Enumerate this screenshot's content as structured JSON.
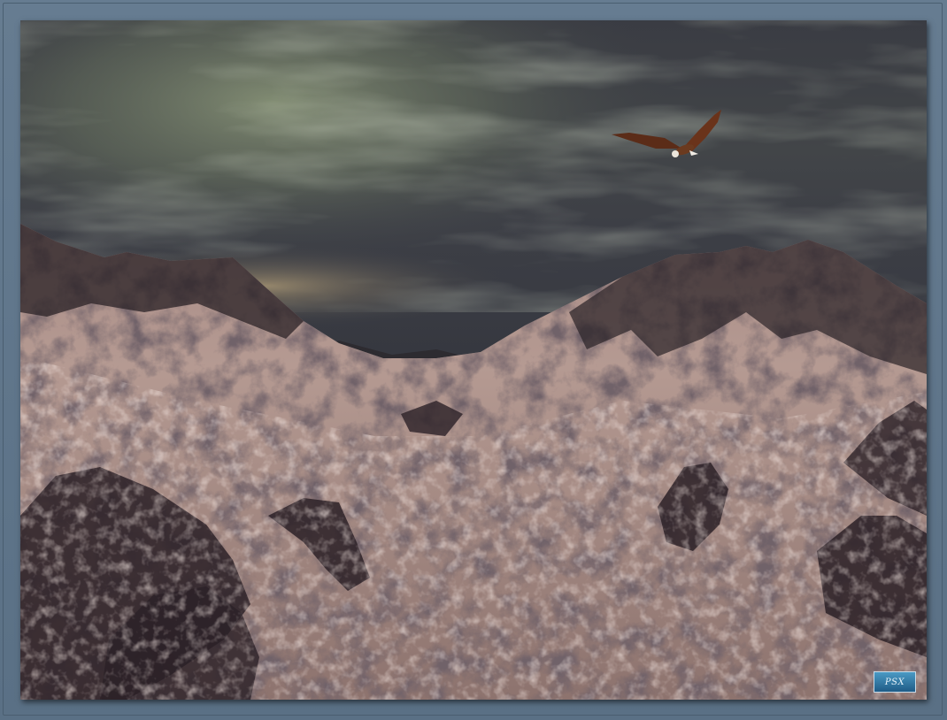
{
  "scene": {
    "subject_icons": [
      "eagle-icon",
      "mountain-range",
      "cloudy-sky"
    ],
    "colors": {
      "frame": "#5d7388",
      "sky_top": "#3b3d44",
      "sky_glow": "#8f9a78",
      "horizon_glow": "#b4a37a",
      "snow": "#d9c3b6",
      "rock": "#2c2328"
    }
  },
  "watermark": {
    "text": "PSX"
  }
}
